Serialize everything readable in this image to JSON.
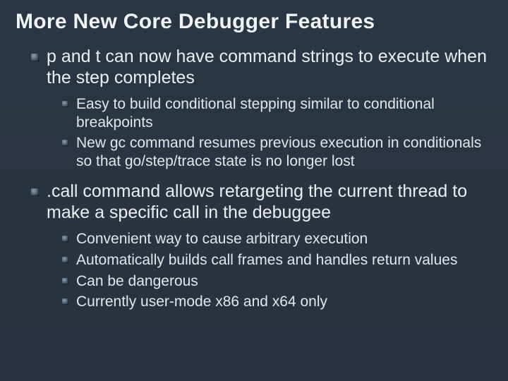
{
  "title": "More New Core Debugger Features",
  "bullets": [
    {
      "text": "p and t can now have command strings to execute when the step completes",
      "sub": [
        "Easy to build conditional stepping similar to conditional breakpoints",
        "New gc command resumes previous execution in conditionals so that go/step/trace state is no longer lost"
      ]
    },
    {
      "text": ".call command allows retargeting the current thread to make a specific call in the debuggee",
      "sub": [
        "Convenient way to cause arbitrary execution",
        "Automatically builds call frames and handles return values",
        "Can be dangerous",
        "Currently user-mode x86 and x64 only"
      ]
    }
  ]
}
